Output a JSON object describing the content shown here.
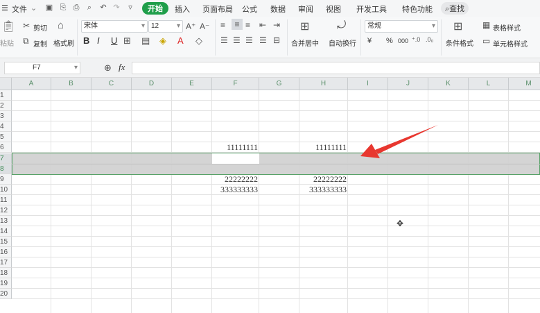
{
  "menubar": {
    "file_label": "文件",
    "tabs": [
      "开始",
      "插入",
      "页面布局",
      "公式",
      "数据",
      "审阅",
      "视图",
      "开发工具",
      "特色功能"
    ],
    "active_tab": "开始",
    "search_label": "查找"
  },
  "ribbon": {
    "paste_label": "粘贴",
    "cut_label": "剪切",
    "copy_label": "复制",
    "format_painter_label": "格式刷",
    "font_name": "宋体",
    "font_size": "12",
    "bold": "B",
    "italic": "I",
    "underline": "U",
    "merge_center_label": "合并居中",
    "wrap_text_label": "自动换行",
    "number_format": "常规",
    "currency_symbol": "¥",
    "percent_symbol": "%",
    "thousands_symbol": "000",
    "conditional_format_label": "条件格式",
    "table_style_label": "表格样式",
    "cell_style_label": "单元格样式"
  },
  "formula_bar": {
    "cell_ref": "F7",
    "fx_label": "fx",
    "value": ""
  },
  "sheet": {
    "columns": [
      "A",
      "B",
      "C",
      "D",
      "E",
      "F",
      "G",
      "H",
      "I",
      "J",
      "K",
      "L",
      "M"
    ],
    "rows": [
      "1",
      "2",
      "3",
      "4",
      "5",
      "6",
      "7",
      "8",
      "9",
      "10",
      "11",
      "12",
      "13",
      "14",
      "15",
      "16",
      "17",
      "18",
      "19",
      "20"
    ],
    "selected_rows": [
      "7",
      "8"
    ],
    "active_cell": "F7",
    "cells": {
      "F6": "11111111",
      "H6": "11111111",
      "F9": "22222222",
      "H9": "22222222",
      "F10": "333333333",
      "H10": "333333333"
    }
  },
  "colors": {
    "accent": "#1f9e4a",
    "selection_fill": "#d2d2d2",
    "selection_border": "#4f9e5f",
    "arrow": "#e8372f"
  }
}
